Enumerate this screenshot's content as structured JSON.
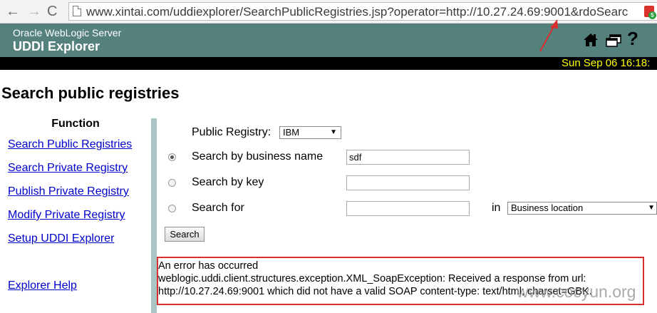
{
  "browser": {
    "url": "www.xintai.com/uddiexplorer/SearchPublicRegistries.jsp?operator=http://10.27.24.69:9001&rdoSearc",
    "ext_badge": "5",
    "back_glyph": "←",
    "forward_glyph": "→",
    "reload_glyph": "C"
  },
  "header": {
    "product_name": "Oracle WebLogic Server",
    "app_title": "UDDI Explorer",
    "datetime": "Sun Sep 06 16:18:",
    "help_glyph": "?",
    "icons": [
      "home-icon",
      "windows-icon",
      "help-icon"
    ]
  },
  "page": {
    "title": "Search public registries"
  },
  "sidebar": {
    "heading": "Function",
    "links": [
      "Search Public Registries",
      "Search Private Registry",
      "Publish Private Registry",
      "Modify Private Registry",
      "Setup UDDI Explorer",
      "Explorer Help"
    ]
  },
  "form": {
    "public_registry_label": "Public Registry:",
    "public_registry_value": "IBM",
    "search_by_business_name_label": "Search by business name",
    "business_name_value": "sdf",
    "search_by_key_label": "Search by key",
    "key_value": "",
    "search_for_label": "Search for",
    "search_for_value": "",
    "in_label": "in",
    "search_in_value": "Business location",
    "selected_option": "search_by_business_name",
    "search_button": "Search"
  },
  "error": {
    "line1": "An error has occurred",
    "line2": "weblogic.uddi.client.structures.exception.XML_SoapException: Received a response from url:",
    "line3": "http://10.27.24.69:9001 which did not have a valid SOAP content-type: text/html; charset=GBK."
  },
  "watermark": "www.cocyun.org",
  "colors": {
    "header_bg": "#55817d",
    "status_bar_bg": "#000000",
    "datetime_color": "#ffff00",
    "link_color": "#0000cc",
    "annotation_red": "#d92e2e",
    "divider": "#a9c4c1"
  }
}
